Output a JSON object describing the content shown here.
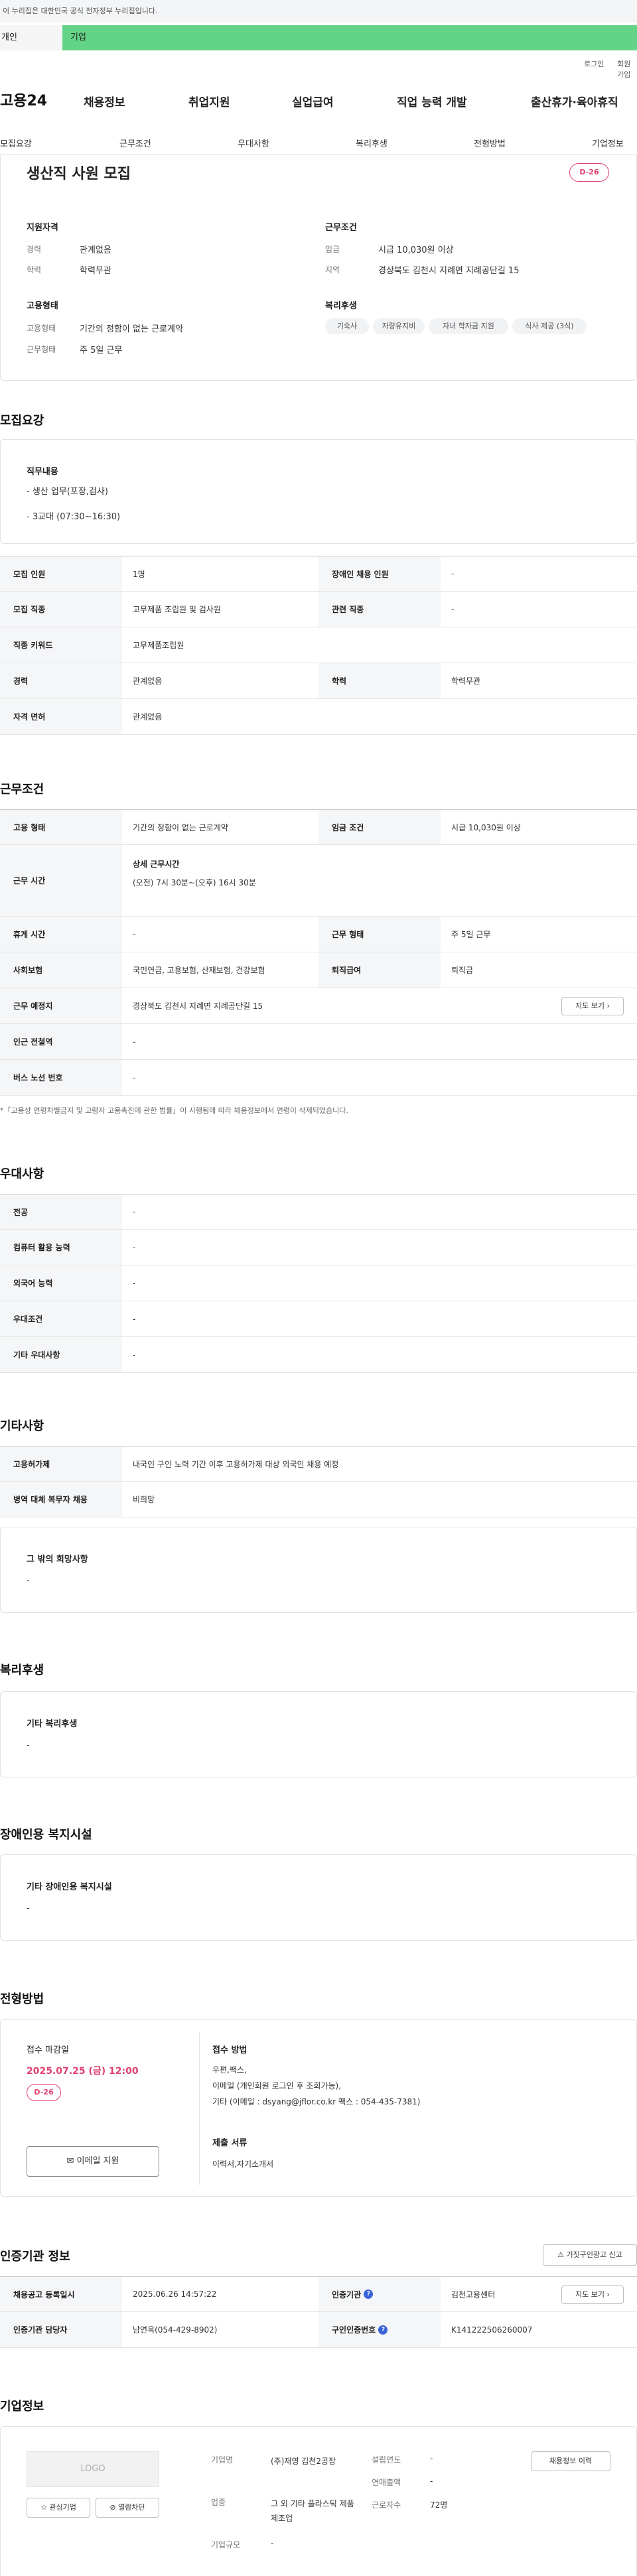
{
  "gov_notice": "이 누리집은 대한민국 공식 전자정부 누리집입니다.",
  "tabs": {
    "personal": "개인",
    "corp": "기업"
  },
  "util": {
    "login": "로그인",
    "join": "회원가입"
  },
  "header": {
    "logo": "고용24",
    "menu": [
      "채용정보",
      "취업지원",
      "실업급여",
      "직업 능력 개발",
      "출산휴가·육아휴직"
    ]
  },
  "subnav": [
    "모집요강",
    "근무조건",
    "우대사항",
    "복리후생",
    "전형방법",
    "기업정보"
  ],
  "summary": {
    "title": "생산직 사원 모집",
    "dday": "D-26",
    "qual": {
      "heading": "지원자격",
      "rows": [
        {
          "label": "경력",
          "value": "관계없음"
        },
        {
          "label": "학력",
          "value": "학력무관"
        }
      ]
    },
    "work": {
      "heading": "근무조건",
      "rows": [
        {
          "label": "임금",
          "value": "시급 10,030원 이상"
        },
        {
          "label": "지역",
          "value": "경상북도 김천시 지례면 지례공단길 15"
        }
      ]
    },
    "emp": {
      "heading": "고용형태",
      "rows": [
        {
          "label": "고용형태",
          "value": "기간의 정함이 없는 근로계약"
        },
        {
          "label": "근무형태",
          "value": "주 5일 근무"
        }
      ]
    },
    "welfare": {
      "heading": "복리후생",
      "chips": [
        "기숙사",
        "자량유지비",
        "자녀 학자금 지원",
        "식사 제공 (3식)"
      ]
    }
  },
  "recruit": {
    "title": "모집요강",
    "duty_heading": "직무내용",
    "duty_lines": [
      "- 생산 업무(포장,검사)",
      "- 3교대 (07:30~16:30)"
    ],
    "table": [
      {
        "k1": "모집 인원",
        "v1": "1명",
        "k2": "장애인 채용 인원",
        "v2": "-"
      },
      {
        "k1": "모집 직종",
        "v1": "고무제품 조립원 및 검사원",
        "k2": "관련 직종",
        "v2": "-"
      },
      {
        "k1": "직종 키워드",
        "v1": "고무제품조립원",
        "k2": "",
        "v2": ""
      },
      {
        "k1": "경력",
        "v1": "관계없음",
        "k2": "학력",
        "v2": "학력무관"
      },
      {
        "k1": "자격 면허",
        "v1": "관계없음",
        "k2": "",
        "v2": ""
      }
    ]
  },
  "conditions": {
    "title": "근무조건",
    "r1": {
      "k1": "고용 형태",
      "v1": "기간의 정함이 없는 근로계약",
      "k2": "임금 조건",
      "v2": "시급 10,030원 이상"
    },
    "r2": {
      "k1": "근무 시간",
      "detail_title": "상세 근무시간",
      "detail": "(오전) 7시 30분~(오후) 16시 30분"
    },
    "r3": {
      "k1": "휴게 시간",
      "v1": "-",
      "k2": "근무 형태",
      "v2": "주 5일 근무"
    },
    "r4": {
      "k1": "사회보험",
      "v1": "국민연금, 고용보험, 산재보험, 건강보험",
      "k2": "퇴직급여",
      "v2": "퇴직금"
    },
    "r5": {
      "k1": "근무 예정지",
      "v1": "경상북도 김천시 지례면 지례공단길 15",
      "btn": "지도 보기"
    },
    "r6": {
      "k1": "인근 전철역",
      "v1": "-"
    },
    "r7": {
      "k1": "버스 노선 번호",
      "v1": "-"
    },
    "note": "*「고용상 연령차별금지 및 고령자 고용촉진에 관한 법률」이 시행됨에 따라 채용정보에서 연령이 삭제되었습니다."
  },
  "prefer": {
    "title": "우대사항",
    "rows": [
      {
        "k": "전공",
        "v": "-"
      },
      {
        "k": "컴퓨터 활용 능력",
        "v": "-"
      },
      {
        "k": "외국어 능력",
        "v": "-"
      },
      {
        "k": "우대조건",
        "v": "-"
      },
      {
        "k": "기타 우대사항",
        "v": "-"
      }
    ]
  },
  "etc": {
    "title": "기타사항",
    "rows": [
      {
        "k": "고용허가제",
        "v": "내국인 구인 노력 기간 이후 고용허가제 대상 외국인 채용 예정"
      },
      {
        "k": "병역 대체 복무자 채용",
        "v": "비희망"
      }
    ],
    "box_heading": "그 밖의 희망사항",
    "box_value": "-"
  },
  "benefit": {
    "title": "복리후생",
    "heading": "기타 복리후생",
    "value": "-"
  },
  "disability": {
    "title": "장애인용 복지시설",
    "heading": "기타 장애인용 복지시설",
    "value": "-"
  },
  "process": {
    "title": "전형방법",
    "deadline_label": "접수 마감일",
    "deadline": "2025.07.25 (금) 12:00",
    "dday": "D-26",
    "email_btn": "이메일 지원",
    "method_label": "접수 방법",
    "method_lines": [
      "우편,팩스,",
      "이메일 (개인회원 로그인 후 조회가능),",
      "기타 (이메일 : dsyang@jflor.co.kr 팩스 : 054-435-7381)"
    ],
    "docs_label": "제출 서류",
    "docs": "이력서,자기소개서"
  },
  "cert": {
    "title": "인증기관 정보",
    "report_btn": "거짓구인광고 신고",
    "r1": {
      "k1": "채용공고 등록일시",
      "v1": "2025.06.26 14:57:22",
      "k2": "인증기관",
      "v2": "김천고용센터",
      "btn": "지도 보기"
    },
    "r2": {
      "k1": "인증기관 담당자",
      "v1": "남연옥(054-429-8902)",
      "k2": "구인인증번호",
      "v2": "K141222506260007"
    }
  },
  "company": {
    "title": "기업정보",
    "logo": "LOGO",
    "fav_btn": "관심기업",
    "block_btn": "열람차단",
    "name_label": "기업명",
    "name": "(주)재영 김천2공장",
    "industry_label": "업종",
    "industry": "그 외 기타 플라스틱 제품 제조업",
    "size_label": "기업규모",
    "size": "-",
    "founded_label": "설립연도",
    "founded": "-",
    "revenue_label": "연매출액",
    "revenue": "-",
    "staff_label": "근로자수",
    "staff": "72명",
    "history_btn": "채용정보 이력"
  },
  "colors": {
    "accent_green": "#63d487",
    "dday_pink": "#e0406f",
    "info_blue": "#3b63d8"
  }
}
